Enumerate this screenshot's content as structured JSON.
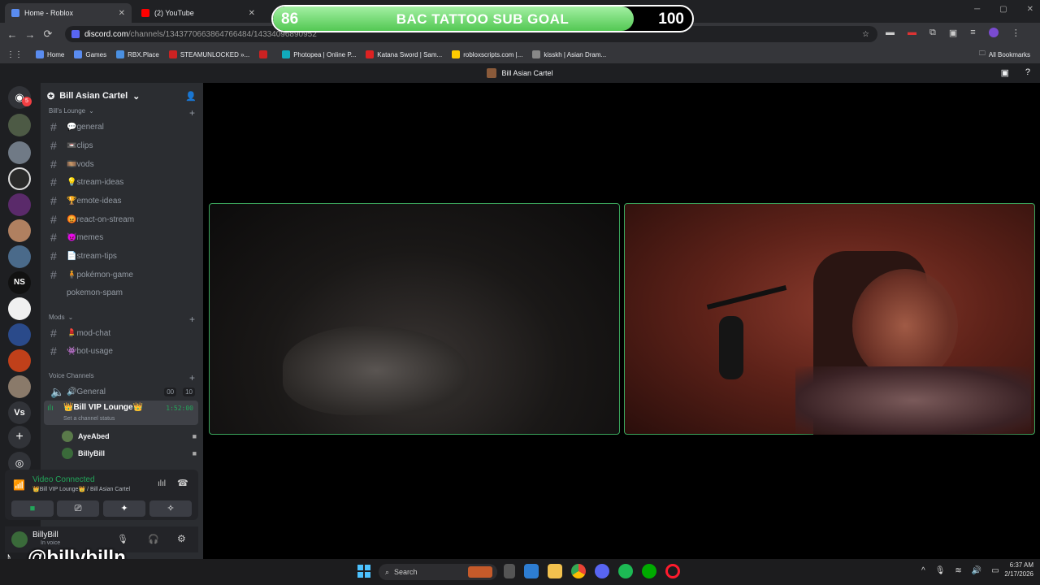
{
  "browser": {
    "tabs": [
      {
        "title": "Home - Roblox",
        "favicon": "roblox-icon"
      },
      {
        "title": "(2) YouTube",
        "favicon": "youtube-icon"
      }
    ],
    "url_host": "discord.com",
    "url_path": "/channels/1343770663864766484/14334096890952",
    "bookmarks": [
      "Home",
      "Games",
      "RBX.Place",
      "STEAMUNLOCKED »...",
      "Photopea | Online P...",
      "Katana Sword | Sam...",
      "robloxscripts.com |...",
      "kisskh | Asian Dram..."
    ],
    "all_bookmarks": "All Bookmarks"
  },
  "overlay": {
    "current": "86",
    "title": "BAC TATTOO SUB GOAL",
    "goal": "100",
    "progress": 0.86,
    "fill_color": "#6fd86f"
  },
  "discord": {
    "window_title": "Bill Asian Cartel",
    "server_name": "Bill Asian Cartel",
    "server_badge": "5",
    "categories": [
      {
        "name": "Bill's Lounge",
        "channels": [
          "💬general",
          "📼clips",
          "🎞️vods",
          "💡stream-ideas",
          "🏆emote-ideas",
          "😡react-on-stream",
          "😈memes",
          "📄stream-tips",
          "🧍pokémon-game",
          "pokemon-spam"
        ]
      },
      {
        "name": "Mods",
        "channels": [
          "💄mod-chat",
          "👾bot-usage"
        ]
      },
      {
        "name": "Voice Channels",
        "channels": []
      }
    ],
    "voice": [
      {
        "name": "🔊General",
        "count_a": "00",
        "count_b": "10"
      },
      {
        "name": "👑Bill VIP Lounge👑",
        "timer": "1:52:00",
        "status": "Set a channel status"
      }
    ],
    "voice_users": [
      "AyeAbed",
      "BillyBill"
    ],
    "vc_panel": {
      "status": "Video Connected",
      "location": "👑Bill VIP Lounge👑 / Bill Asian Cartel"
    },
    "user": {
      "name": "BillyBill",
      "status": "In voice"
    },
    "server_labels": [
      "NS",
      "Vs"
    ]
  },
  "watermark": "@billybilln",
  "taskbar": {
    "search": "Search",
    "time": "6:37 AM",
    "date": "2/17/2026"
  }
}
